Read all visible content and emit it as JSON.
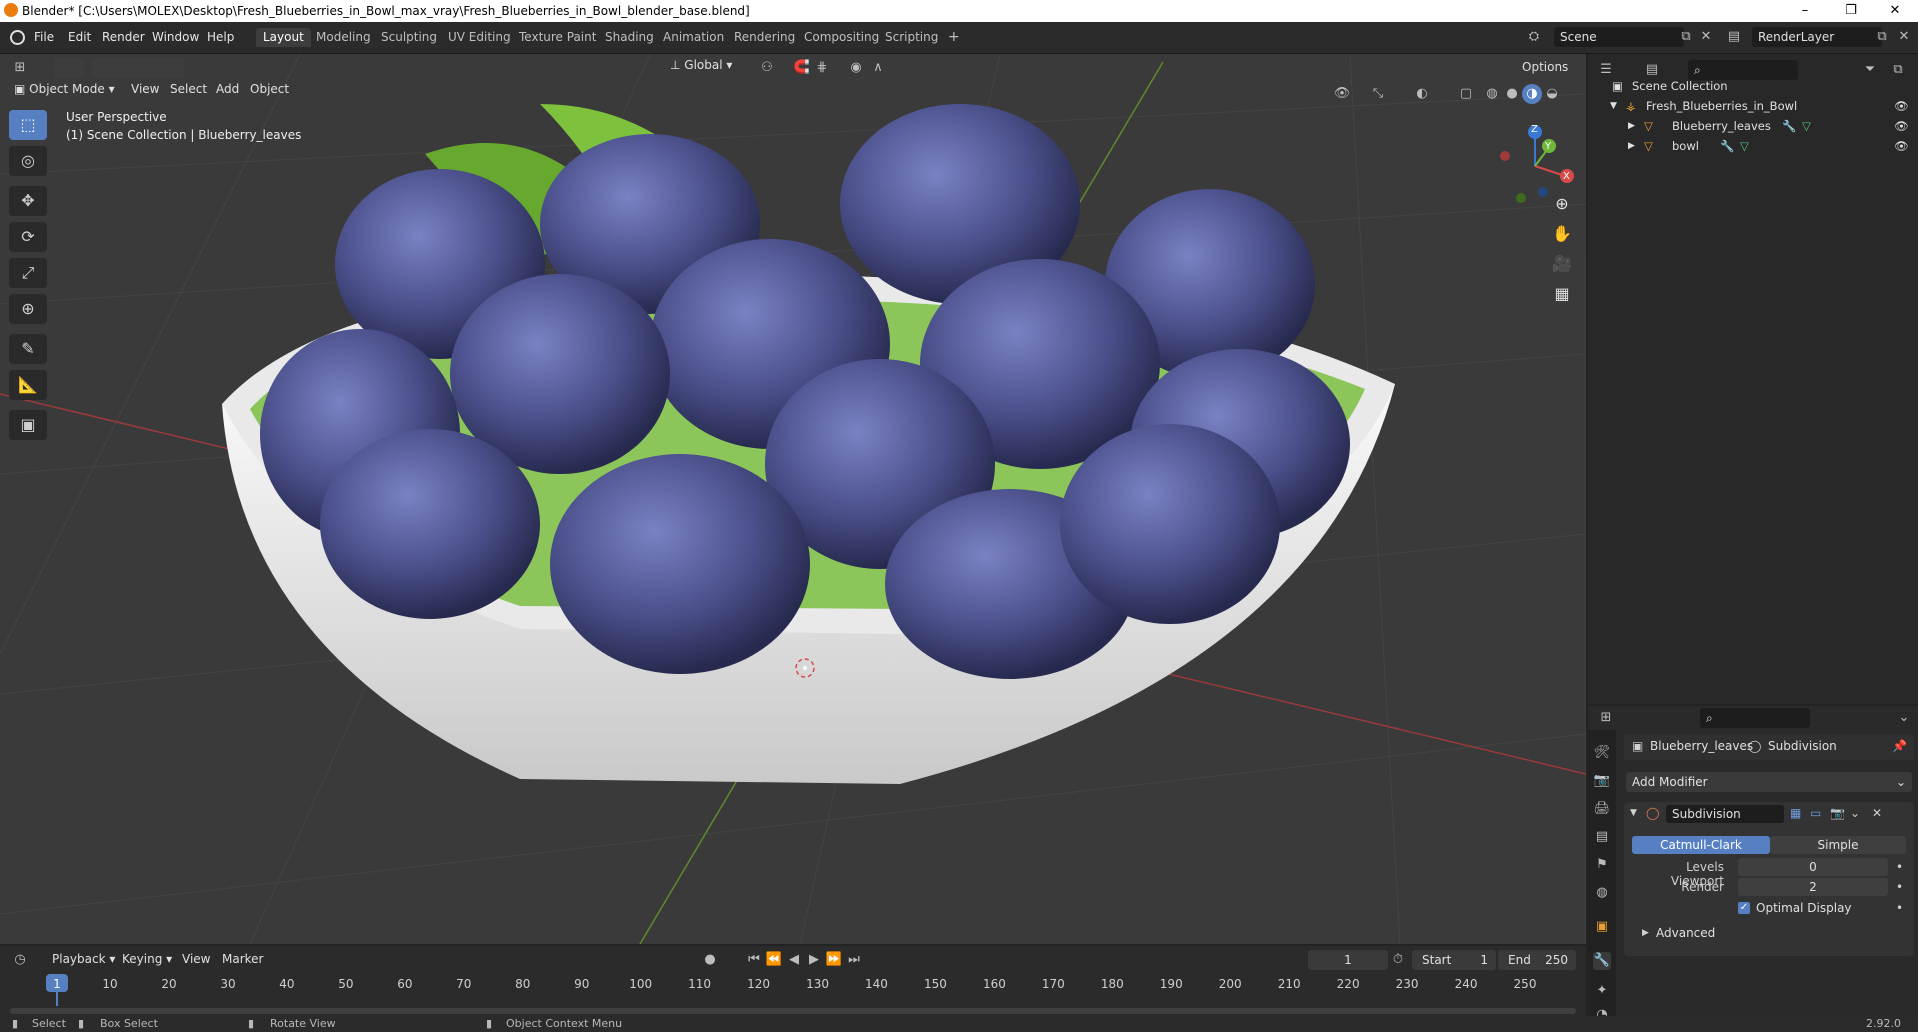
{
  "window": {
    "title": "Blender* [C:\\Users\\MOLEX\\Desktop\\Fresh_Blueberries_in_Bowl_max_vray\\Fresh_Blueberries_in_Bowl_blender_base.blend]",
    "min": "–",
    "restore": "❐",
    "close": "✕"
  },
  "menu": [
    "File",
    "Edit",
    "Render",
    "Window",
    "Help"
  ],
  "workspaces": [
    {
      "label": "Layout",
      "active": true
    },
    {
      "label": "Modeling"
    },
    {
      "label": "Sculpting"
    },
    {
      "label": "UV Editing"
    },
    {
      "label": "Texture Paint"
    },
    {
      "label": "Shading"
    },
    {
      "label": "Animation"
    },
    {
      "label": "Rendering"
    },
    {
      "label": "Compositing"
    },
    {
      "label": "Scripting"
    }
  ],
  "add_workspace": "+",
  "scene_name": "Scene",
  "render_layer": "RenderLayer",
  "viewport": {
    "mode": "Object Mode",
    "menus": [
      "View",
      "Select",
      "Add",
      "Object"
    ],
    "transform_orientation": "Global",
    "options": "Options",
    "perspective": "User Perspective",
    "collection_info": "(1) Scene Collection | Blueberry_leaves",
    "gizmo": {
      "x": "X",
      "y": "Y",
      "z": "Z"
    }
  },
  "outliner": {
    "rows": [
      {
        "label": "Scene Collection",
        "indent": 0
      },
      {
        "label": "Fresh_Blueberries_in_Bowl",
        "indent": 1
      },
      {
        "label": "Blueberry_leaves",
        "indent": 2
      },
      {
        "label": "bowl",
        "indent": 2
      }
    ]
  },
  "properties": {
    "object": "Blueberry_leaves",
    "modifier_tab": "Subdivision",
    "add_modifier": "Add Modifier",
    "modifier_name": "Subdivision",
    "method_options": [
      "Catmull-Clark",
      "Simple"
    ],
    "method_selected": "Catmull-Clark",
    "levels_viewport_label": "Levels Viewport",
    "levels_viewport": "0",
    "render_label": "Render",
    "render_value": "2",
    "optimal_display": "Optimal Display",
    "advanced": "Advanced"
  },
  "timeline": {
    "menus": [
      "Playback",
      "Keying",
      "View",
      "Marker"
    ],
    "current_frame": "1",
    "start_label": "Start",
    "start": "1",
    "end_label": "End",
    "end": "250",
    "ticks": [
      "1",
      "10",
      "20",
      "30",
      "40",
      "50",
      "60",
      "70",
      "80",
      "90",
      "100",
      "110",
      "120",
      "130",
      "140",
      "150",
      "160",
      "170",
      "180",
      "190",
      "200",
      "210",
      "220",
      "230",
      "240",
      "250"
    ]
  },
  "statusbar": {
    "select": "Select",
    "box_select": "Box Select",
    "rotate_view": "Rotate View",
    "context_menu": "Object Context Menu",
    "version": "2.92.0"
  },
  "colors": {
    "accent": "#5680c2",
    "header": "#2b2b2b",
    "viewport_bg": "#3a3a3a",
    "blueberry": "#4a4f8a",
    "leaf": "#6fb63a",
    "bowl": "#e8e8e8"
  }
}
